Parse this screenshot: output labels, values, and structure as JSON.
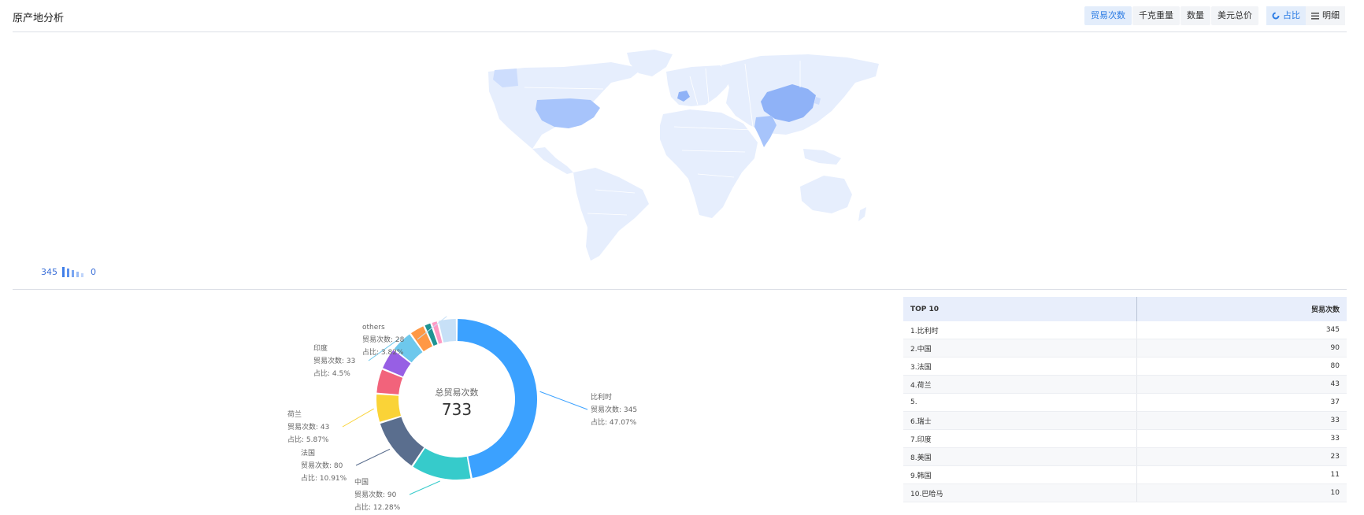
{
  "header": {
    "title": "原产地分析",
    "metric_tabs": [
      "贸易次数",
      "千克重量",
      "数量",
      "美元总价"
    ],
    "view_tabs": [
      "占比",
      "明细"
    ]
  },
  "map": {
    "legend_max": "345",
    "legend_min": "0",
    "base_color": "#e6eefd",
    "highlight_colors": {
      "strong": "#8fb2f7",
      "medium": "#a7c4fb",
      "light": "#cdddfd"
    }
  },
  "chart_data": {
    "type": "pie",
    "center_label": "总贸易次数",
    "center_value": "733",
    "series_label": "贸易次数",
    "share_label": "占比",
    "slices": [
      {
        "name": "比利时",
        "value": 345,
        "percent": "47.07%",
        "color": "#3ba1ff"
      },
      {
        "name": "中国",
        "value": 90,
        "percent": "12.28%",
        "color": "#36cbcb"
      },
      {
        "name": "法国",
        "value": 80,
        "percent": "10.91%",
        "color": "#5a6e8e"
      },
      {
        "name": "荷兰",
        "value": 43,
        "percent": "5.87%",
        "color": "#fad337"
      },
      {
        "name": "",
        "value": 37,
        "percent": "",
        "color": "#f2637b"
      },
      {
        "name": "",
        "value": 33,
        "percent": "",
        "color": "#975fe4"
      },
      {
        "name": "印度",
        "value": 33,
        "percent": "4.5%",
        "color": "#6dc8ec"
      },
      {
        "name": "",
        "value": 23,
        "percent": "",
        "color": "#ff9845"
      },
      {
        "name": "",
        "value": 11,
        "percent": "",
        "color": "#1e9493"
      },
      {
        "name": "",
        "value": 10,
        "percent": "",
        "color": "#ff99c3"
      },
      {
        "name": "others",
        "value": 28,
        "percent": "3.82%",
        "color": "#c7e0f7"
      }
    ]
  },
  "table": {
    "headers": [
      "TOP 10",
      "贸易次数"
    ],
    "rows": [
      {
        "name": "1.比利时",
        "value": "345"
      },
      {
        "name": "2.中国",
        "value": "90"
      },
      {
        "name": "3.法国",
        "value": "80"
      },
      {
        "name": "4.荷兰",
        "value": "43"
      },
      {
        "name": "5.",
        "value": "37"
      },
      {
        "name": "6.瑞士",
        "value": "33"
      },
      {
        "name": "7.印度",
        "value": "33"
      },
      {
        "name": "8.美国",
        "value": "23"
      },
      {
        "name": "9.韩国",
        "value": "11"
      },
      {
        "name": "10.巴哈马",
        "value": "10"
      }
    ]
  }
}
